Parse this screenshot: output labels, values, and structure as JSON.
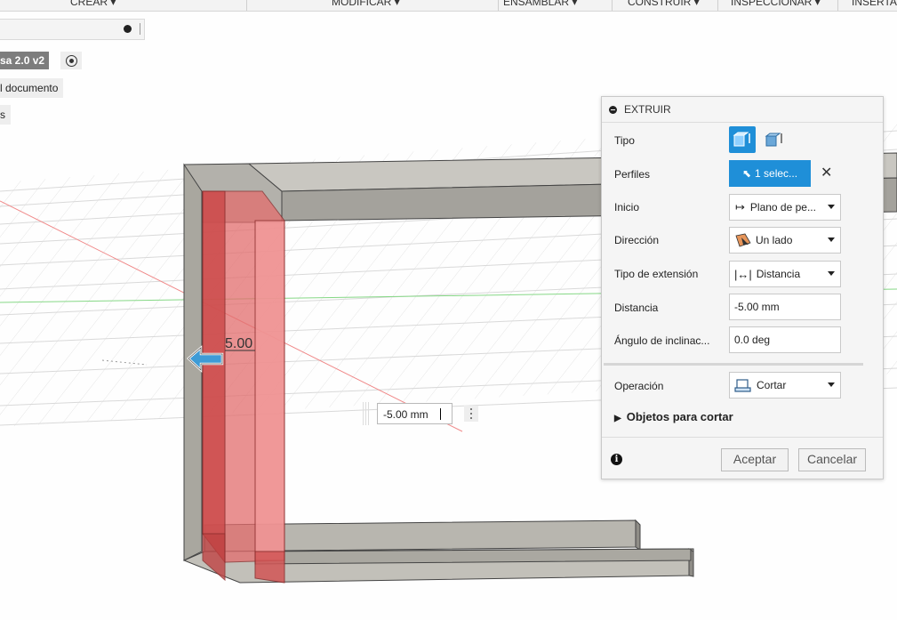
{
  "toolbar": {
    "items": [
      "CREAR ▾",
      "MODIFICAR ▾",
      "ENSAMBLAR ▾",
      "CONSTRUIR ▾",
      "INSPECCIONAR ▾",
      "INSERTA"
    ]
  },
  "browser": {
    "component_label": "sa 2.0 v2",
    "rows": [
      "l documento",
      "s"
    ]
  },
  "viewport": {
    "dimension_label": "5.00",
    "distance_input_value": "-5.00 mm"
  },
  "extrude_panel": {
    "title": "EXTRUIR",
    "labels": {
      "tipo": "Tipo",
      "perfiles": "Perfiles",
      "inicio": "Inicio",
      "direccion": "Dirección",
      "tipo_extension": "Tipo de extensión",
      "distancia": "Distancia",
      "angulo": "Ángulo de inclinac...",
      "operacion": "Operación"
    },
    "values": {
      "perfiles": "1 selec...",
      "inicio": "Plano de pe...",
      "direccion": "Un lado",
      "tipo_extension": "Distancia",
      "distancia": "-5.00 mm",
      "angulo": "0.0 deg",
      "operacion": "Cortar"
    },
    "objetos_label": "Objetos para cortar",
    "accept_label": "Aceptar",
    "cancel_label": "Cancelar"
  },
  "colors": {
    "accent": "#1f8fd8",
    "cut_body": "#e05a5a",
    "geometry": "#b0aea8"
  }
}
